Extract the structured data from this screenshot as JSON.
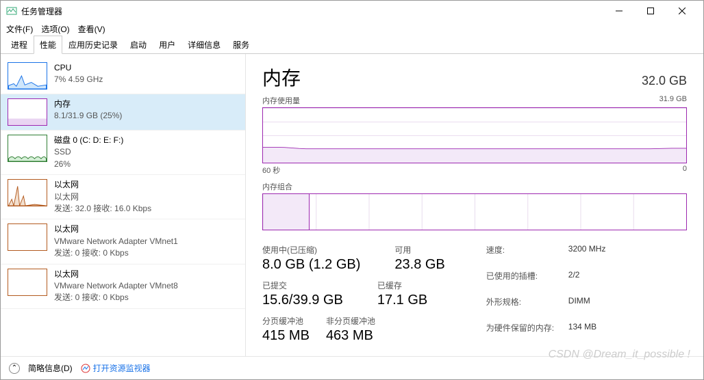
{
  "window": {
    "title": "任务管理器"
  },
  "menu": {
    "file": "文件(F)",
    "options": "选项(O)",
    "view": "查看(V)"
  },
  "tabs": [
    "进程",
    "性能",
    "应用历史记录",
    "启动",
    "用户",
    "详细信息",
    "服务"
  ],
  "activeTab": 1,
  "sidebar": [
    {
      "kind": "cpu",
      "name": "CPU",
      "sub": "7% 4.59 GHz"
    },
    {
      "kind": "mem",
      "name": "内存",
      "sub": "8.1/31.9 GB (25%)",
      "selected": true
    },
    {
      "kind": "disk",
      "name": "磁盘 0 (C: D: E: F:)",
      "sub": "SSD",
      "sub2": "26%"
    },
    {
      "kind": "eth1",
      "name": "以太网",
      "sub": "以太网",
      "sub2": "发送: 32.0 接收: 16.0 Kbps"
    },
    {
      "kind": "eth2",
      "name": "以太网",
      "sub": "VMware Network Adapter VMnet1",
      "sub2": "发送: 0 接收: 0 Kbps"
    },
    {
      "kind": "eth3",
      "name": "以太网",
      "sub": "VMware Network Adapter VMnet8",
      "sub2": "发送: 0 接收: 0 Kbps"
    }
  ],
  "main": {
    "title": "内存",
    "capacity": "32.0 GB",
    "usageLabel": "内存使用量",
    "usageMax": "31.9 GB",
    "xStart": "60 秒",
    "xEnd": "0",
    "compLabel": "内存组合",
    "stats": {
      "inuse_lbl": "使用中(已压缩)",
      "inuse": "8.0 GB (1.2 GB)",
      "avail_lbl": "可用",
      "avail": "23.8 GB",
      "commit_lbl": "已提交",
      "commit": "15.6/39.9 GB",
      "cached_lbl": "已缓存",
      "cached": "17.1 GB",
      "paged_lbl": "分页缓冲池",
      "paged": "415 MB",
      "nonpaged_lbl": "非分页缓冲池",
      "nonpaged": "463 MB"
    },
    "kv": {
      "speed_k": "速度:",
      "speed_v": "3200 MHz",
      "slots_k": "已使用的插槽:",
      "slots_v": "2/2",
      "form_k": "外形规格:",
      "form_v": "DIMM",
      "reserved_k": "为硬件保留的内存:",
      "reserved_v": "134 MB"
    }
  },
  "footer": {
    "brief": "简略信息(D)",
    "resmon": "打开资源监视器"
  },
  "watermark": "CSDN @Dream_it_possible !",
  "chart_data": {
    "type": "line",
    "title": "内存使用量",
    "xlabel": "秒",
    "ylabel": "GB",
    "x_range": [
      60,
      0
    ],
    "ylim": [
      0,
      31.9
    ],
    "series": [
      {
        "name": "内存",
        "values": [
          9.0,
          9.0,
          9.0,
          8.9,
          8.6,
          8.3,
          8.1,
          8.1,
          8.1,
          8.1,
          8.1,
          8.1,
          8.1,
          8.1,
          8.1,
          8.1,
          8.1,
          8.1,
          8.1,
          8.1,
          8.1,
          8.1,
          8.1,
          8.1,
          8.1,
          8.1,
          8.1,
          8.1,
          8.1,
          8.1,
          8.1,
          8.1,
          8.1,
          8.1,
          8.1,
          8.1,
          8.1,
          8.1,
          8.1,
          8.1,
          8.1,
          8.1,
          8.1,
          8.1,
          8.1,
          8.1,
          8.1,
          8.1,
          8.1,
          8.1,
          8.1,
          8.1,
          8.1,
          8.1,
          8.1,
          8.2,
          8.3,
          8.4,
          8.4,
          8.4
        ]
      }
    ]
  }
}
